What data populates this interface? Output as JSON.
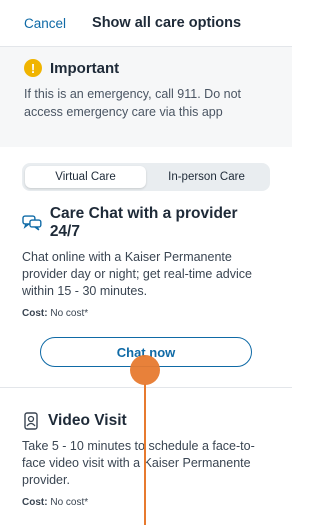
{
  "header": {
    "cancel": "Cancel",
    "title": "Show all care options"
  },
  "important": {
    "icon": "warning-icon",
    "icon_glyph": "!",
    "title": "Important",
    "text": "If this is an emergency, call 911. Do not access emergency care via this app"
  },
  "tabs": [
    {
      "label": "Virtual Care",
      "active": true
    },
    {
      "label": "In-person Care",
      "active": false
    }
  ],
  "chat_card": {
    "icon": "chat-bubbles-icon",
    "title": "Care Chat with a provider 24/7",
    "description": "Chat online with a Kaiser Permanente provider day or night; get real-time advice within 15 - 30 minutes.",
    "cost_label": "Cost:",
    "cost_value": " No cost*",
    "button": "Chat now"
  },
  "video_card": {
    "icon": "video-tablet-icon",
    "title": "Video Visit",
    "description": "Take 5 - 10 minutes to schedule a face-to-face video visit with a Kaiser Permanente provider.",
    "cost_label": "Cost:",
    "cost_value": " No cost*"
  },
  "colors": {
    "accent": "#0f6aa6",
    "warning": "#f0b400",
    "touch_indicator": "#e77a2f"
  }
}
